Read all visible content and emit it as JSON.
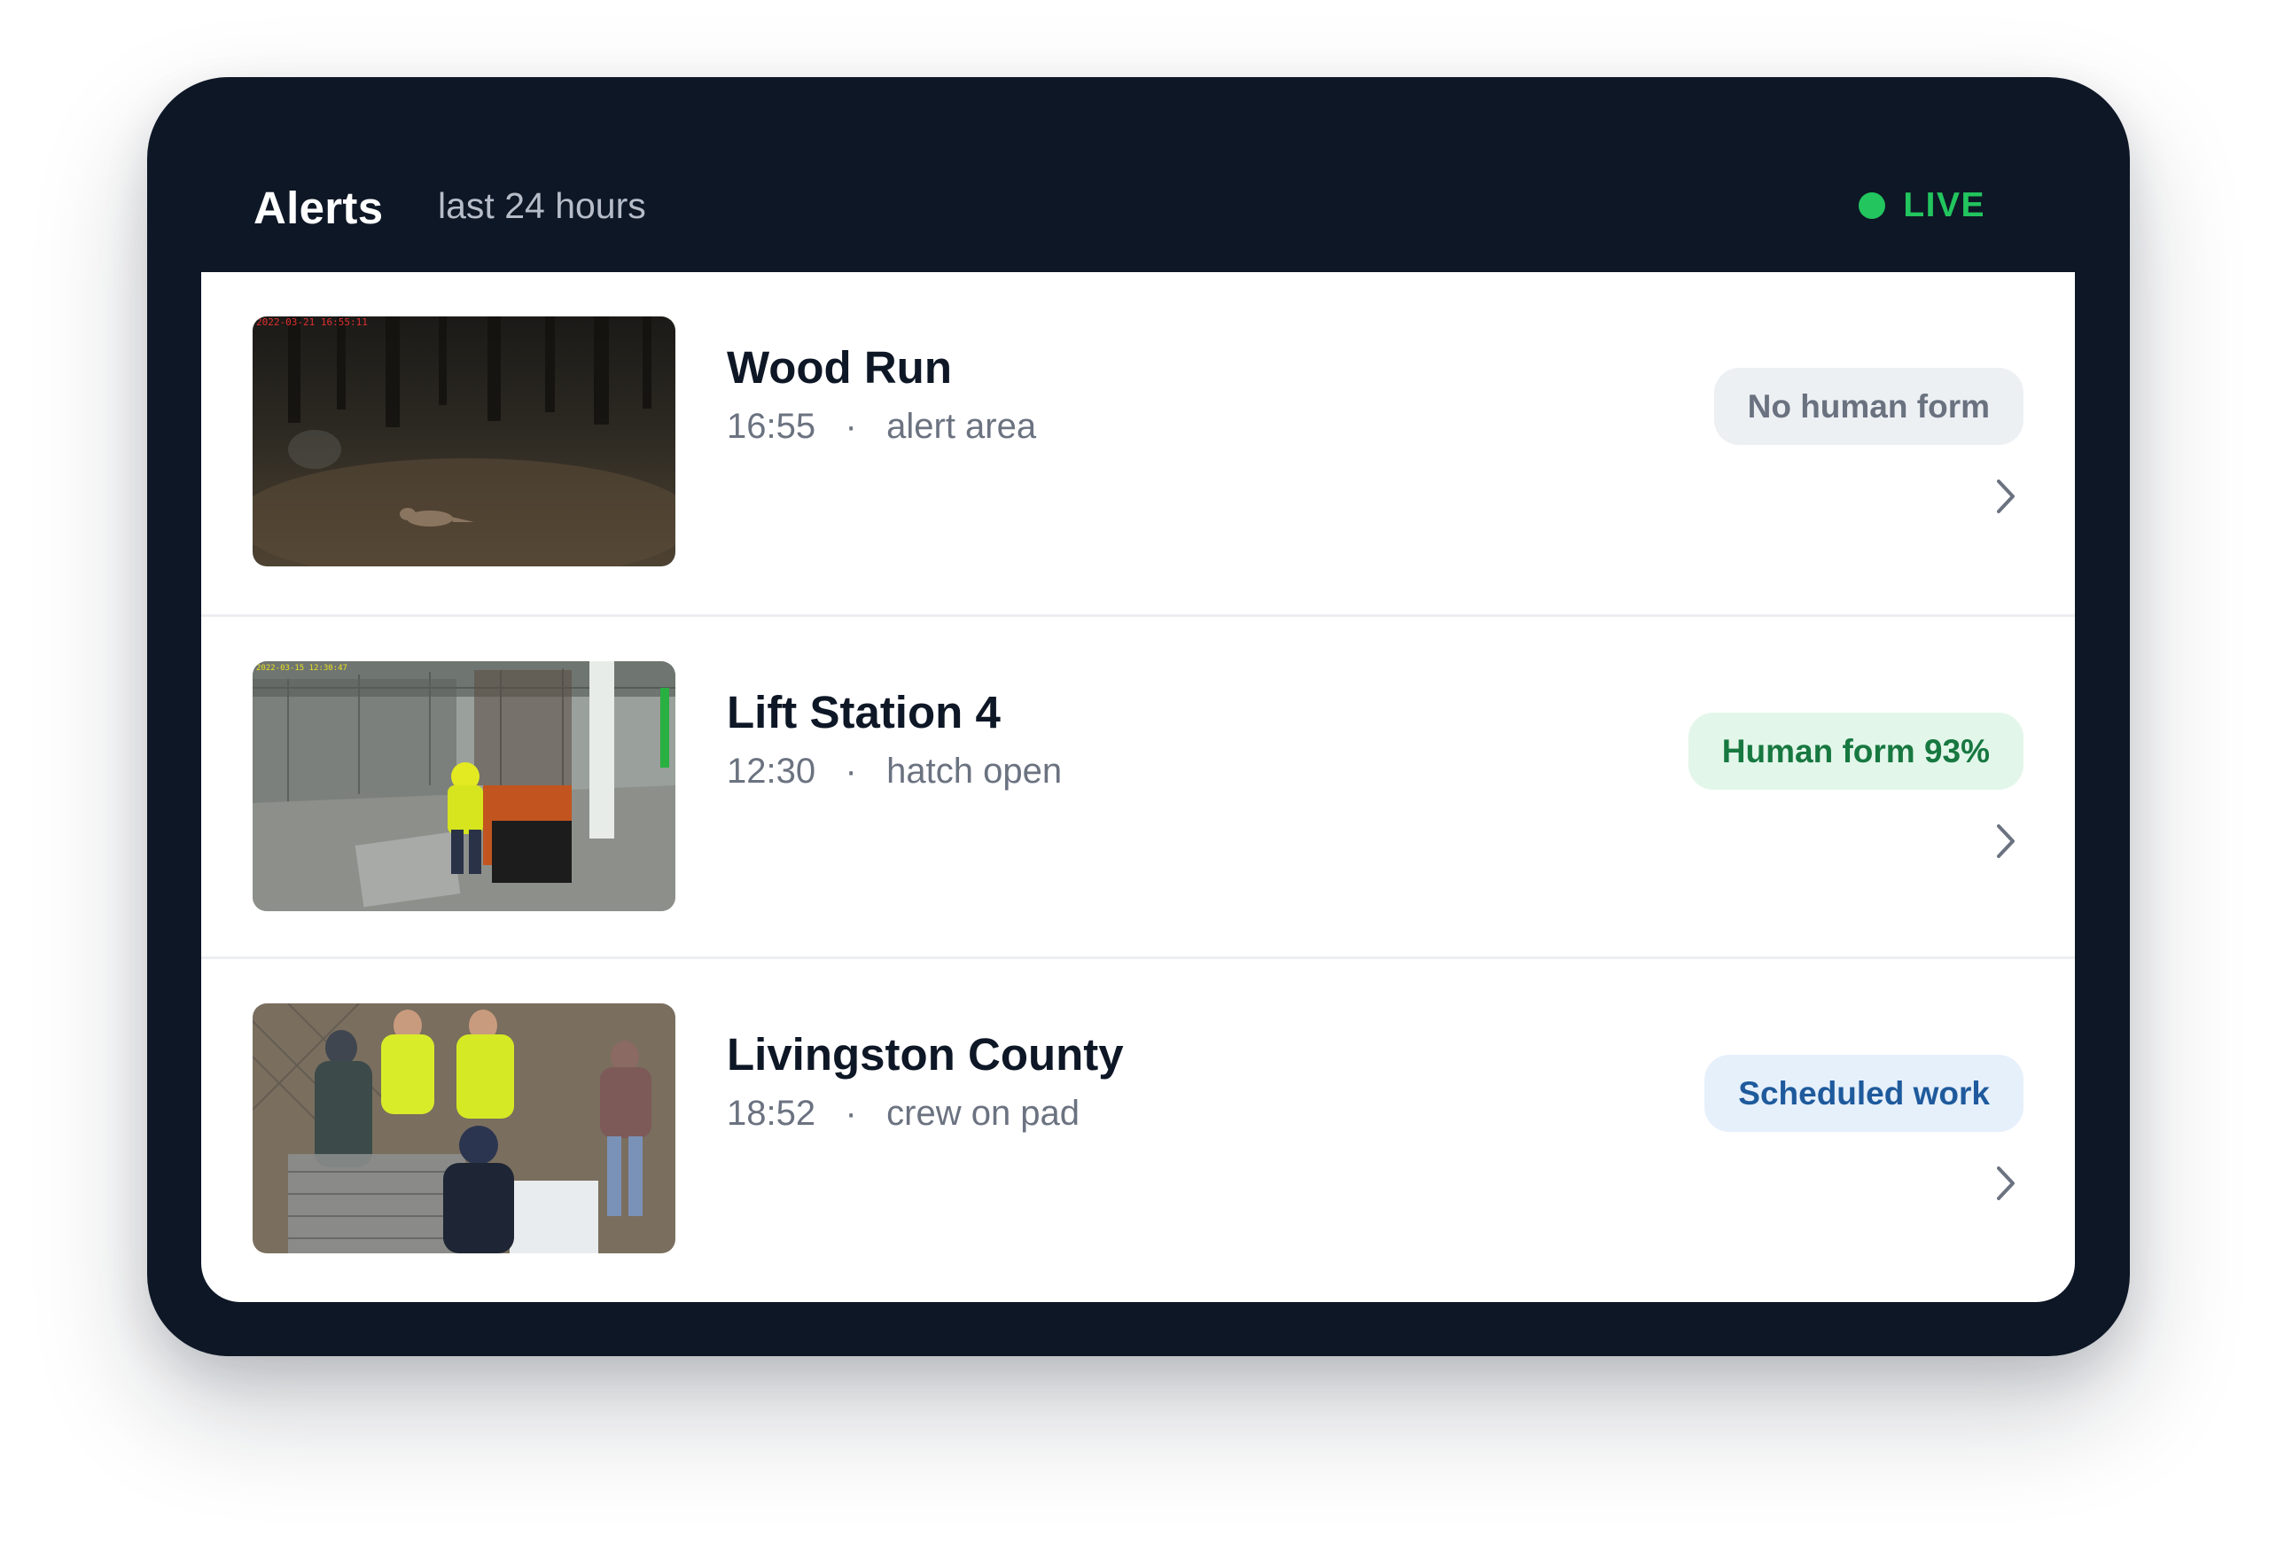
{
  "header": {
    "title": "Alerts",
    "subtitle": "last 24 hours",
    "live_label": "LIVE",
    "live_color": "#22c55e"
  },
  "alerts": [
    {
      "name": "Wood Run",
      "time": "16:55",
      "separator": "·",
      "event": "alert area",
      "badge": "No human form",
      "badge_tone": "gray",
      "thumbnail": "night-camera-animal",
      "camera_overlay": "2022-03-21 16:55:11"
    },
    {
      "name": "Lift Station 4",
      "time": "12:30",
      "separator": "·",
      "event": "hatch open",
      "badge": "Human form 93%",
      "badge_tone": "green",
      "thumbnail": "worker-at-hatch",
      "camera_overlay": "2022-03-15 12:30:47"
    },
    {
      "name": "Livingston County",
      "time": "18:52",
      "separator": "·",
      "event": "crew on pad",
      "badge": "Scheduled work",
      "badge_tone": "blue",
      "thumbnail": "crew-on-pad"
    }
  ],
  "colors": {
    "frame": "#0e1726",
    "badge_gray": "#edf0f3",
    "badge_green": "#e3f6ea",
    "badge_blue": "#e6f0fb"
  }
}
